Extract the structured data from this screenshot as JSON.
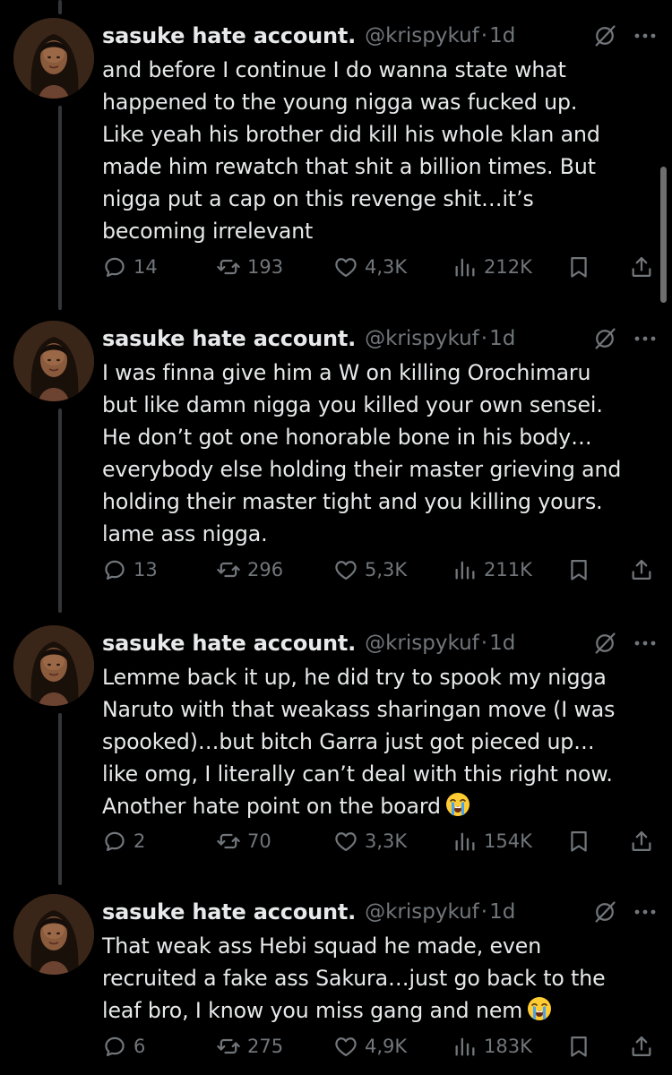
{
  "tweets": [
    {
      "name": "sasuke hate account.",
      "handle": "@krispykuf",
      "dot": "·",
      "time": "1d",
      "lines": [
        "and before I continue I do wanna state what",
        "happened to the young nigga was fucked up.",
        "Like yeah his brother did kill his whole klan and",
        "made him rewatch that shit a billion times. But",
        "nigga put a cap on this revenge shit…it’s",
        "becoming irrelevant"
      ],
      "replies": "14",
      "reposts": "193",
      "likes": "4,3K",
      "views": "212K"
    },
    {
      "name": "sasuke hate account.",
      "handle": "@krispykuf",
      "dot": "·",
      "time": "1d",
      "lines": [
        "I was finna give him a W on killing Orochimaru",
        "but like damn nigga you killed your own sensei.",
        "He don’t got one honorable bone in his body…",
        "everybody else holding their master grieving and",
        "holding their master tight and you killing yours.",
        "lame ass nigga."
      ],
      "replies": "13",
      "reposts": "296",
      "likes": "5,3K",
      "views": "211K"
    },
    {
      "name": "sasuke hate account.",
      "handle": "@krispykuf",
      "dot": "·",
      "time": "1d",
      "lines": [
        "Lemme back it up, he did try to spook my nigga",
        "Naruto with that weakass sharingan move (I was",
        "spooked)…but bitch Garra just got pieced up…",
        "like omg, I literally can’t deal with this right now.",
        "Another hate point on the board"
      ],
      "replies": "2",
      "reposts": "70",
      "likes": "3,3K",
      "views": "154K"
    },
    {
      "name": "sasuke hate account.",
      "handle": "@krispykuf",
      "dot": "·",
      "time": "1d",
      "lines": [
        "That weak ass Hebi squad he made, even",
        "recruited a fake ass Sakura…just go back to the",
        "leaf bro, I know you miss gang and nem"
      ],
      "replies": "6",
      "reposts": "275",
      "likes": "4,9K",
      "views": "183K"
    }
  ],
  "icons": {
    "reply": "reply-icon",
    "repost": "repost-icon",
    "like": "heart-icon",
    "views": "views-icon",
    "bookmark": "bookmark-icon",
    "share": "share-icon",
    "grok": "grok-icon",
    "more": "more-icon",
    "emoji": "loudly-crying-face-emoji"
  },
  "colors": {
    "background": "#000000",
    "text": "#e7e9ea",
    "secondary": "#71767b",
    "thread_line": "#333639"
  }
}
